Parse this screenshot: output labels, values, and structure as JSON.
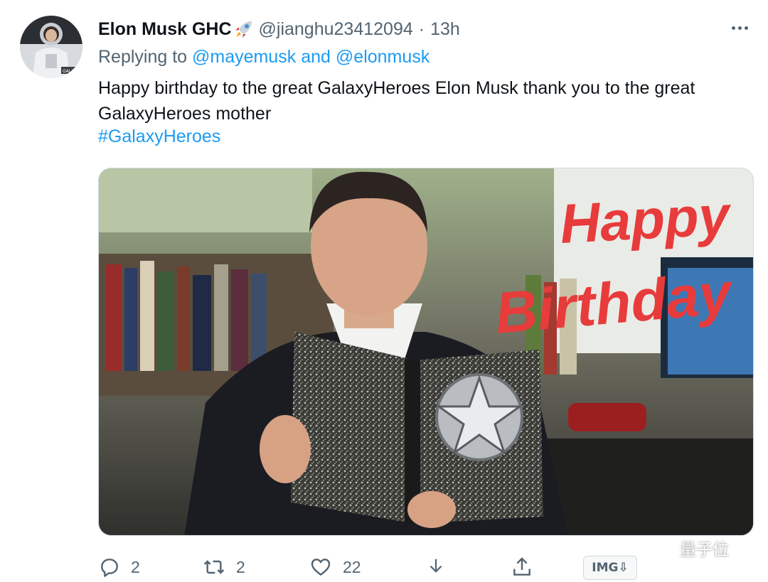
{
  "tweet": {
    "author_name": "Elon Musk GHC",
    "author_emoji": "rocket-icon",
    "handle": "@jianghu23412094",
    "separator": "·",
    "time": "13h",
    "replying_prefix": "Replying to",
    "replying_to_1": "@mayemusk",
    "replying_joiner": "and",
    "replying_to_2": "@elonmusk",
    "text": "Happy birthday to the great GalaxyHeroes Elon Musk thank you to the great GalaxyHeroes mother",
    "hashtag": "#GalaxyHeroes",
    "media_caption_line1": "Happy",
    "media_caption_line2": "Birthday",
    "avatar_badge_text": "GALAXY"
  },
  "actions": {
    "reply_count": "2",
    "retweet_count": "2",
    "like_count": "22"
  },
  "badge": {
    "label": "IMG⇩"
  },
  "watermark": {
    "text": "量子位"
  },
  "colors": {
    "link": "#1d9bf0",
    "muted": "#536471",
    "text": "#0f1419",
    "caption": "#e83b3b"
  }
}
